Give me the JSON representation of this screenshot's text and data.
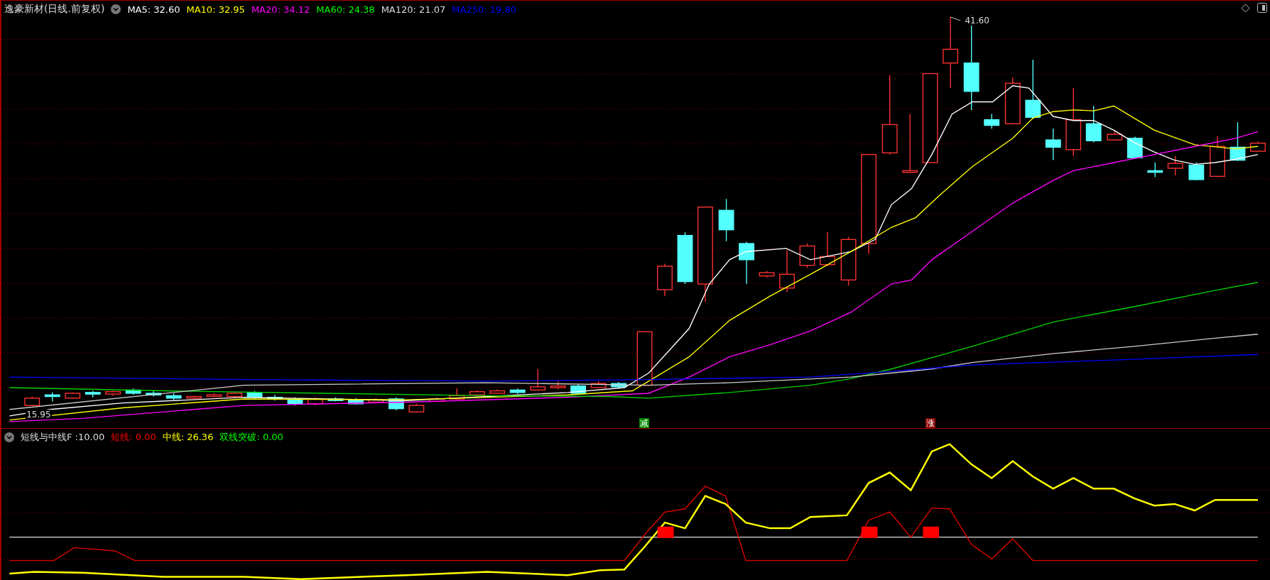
{
  "title": "逸豪新材(日线.前复权)",
  "ma_legend": [
    {
      "label": "MA5: 32.60",
      "color": "#ffffff"
    },
    {
      "label": "MA10: 32.95",
      "color": "#ffff00"
    },
    {
      "label": "MA20: 34.12",
      "color": "#ff00ff"
    },
    {
      "label": "MA60: 24.38",
      "color": "#00ff00"
    },
    {
      "label": "MA120: 21.07",
      "color": "#dcdcdc"
    },
    {
      "label": "MA250: 19.80",
      "color": "#0000ff"
    }
  ],
  "price_chart": {
    "high_label": "41.60",
    "low_label": "15.95",
    "signals": [
      {
        "text": "减",
        "kind": "reduce"
      },
      {
        "text": "涨",
        "kind": "rise"
      }
    ]
  },
  "indicator": {
    "title": "短线与中线F :10.00",
    "values": [
      {
        "label": "短线: 0.00",
        "color": "#ff0000"
      },
      {
        "label": "中线: 26.36",
        "color": "#ffff00"
      },
      {
        "label": "双线突破: 0.00",
        "color": "#00ff00"
      }
    ]
  }
}
